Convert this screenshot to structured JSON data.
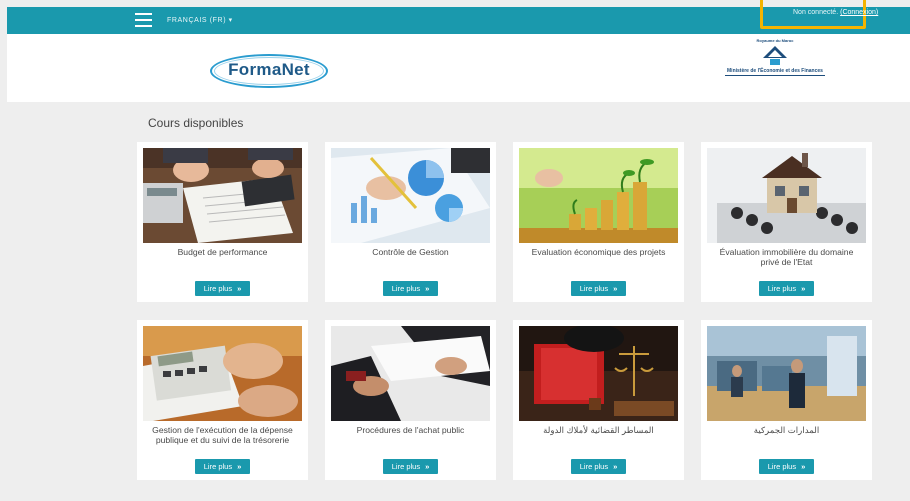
{
  "topbar": {
    "menu_icon": "hamburger-icon",
    "language": "FRANÇAIS (FR) ▾",
    "status": "Non connecté.",
    "login_link": "(Connexion)",
    "bar_color": "#1a99ad",
    "highlight_color": "#f4b400"
  },
  "header": {
    "logo_text": "FormaNet",
    "ministry_tag": "Royaume du Maroc",
    "ministry_name": "Ministère de l'Économie et des Finances"
  },
  "main": {
    "section_title": "Cours disponibles",
    "courses": [
      {
        "title": "Budget de performance",
        "button": "Lire plus",
        "image": "calculator-documents-photo"
      },
      {
        "title": "Contrôle de Gestion",
        "button": "Lire plus",
        "image": "charts-pen-photo"
      },
      {
        "title": "Evaluation économique des projets",
        "button": "Lire plus",
        "image": "coins-plants-photo"
      },
      {
        "title": "Évaluation immobilière du domaine privé de l'Etat",
        "button": "Lire plus",
        "image": "house-calculator-photo"
      },
      {
        "title": "Gestion de l'exécution de la dépense publique et du suivi de la trésorerie",
        "button": "Lire plus",
        "image": "calculator-hands-photo"
      },
      {
        "title": "Procédures de l'achat public",
        "button": "Lire plus",
        "image": "handshake-documents-photo"
      },
      {
        "title": "المساطر القضائية لأملاك الدولة",
        "button": "Lire plus",
        "image": "judge-gavel-photo"
      },
      {
        "title": "المدارات الجمركية",
        "button": "Lire plus",
        "image": "customs-hall-photo"
      }
    ]
  }
}
